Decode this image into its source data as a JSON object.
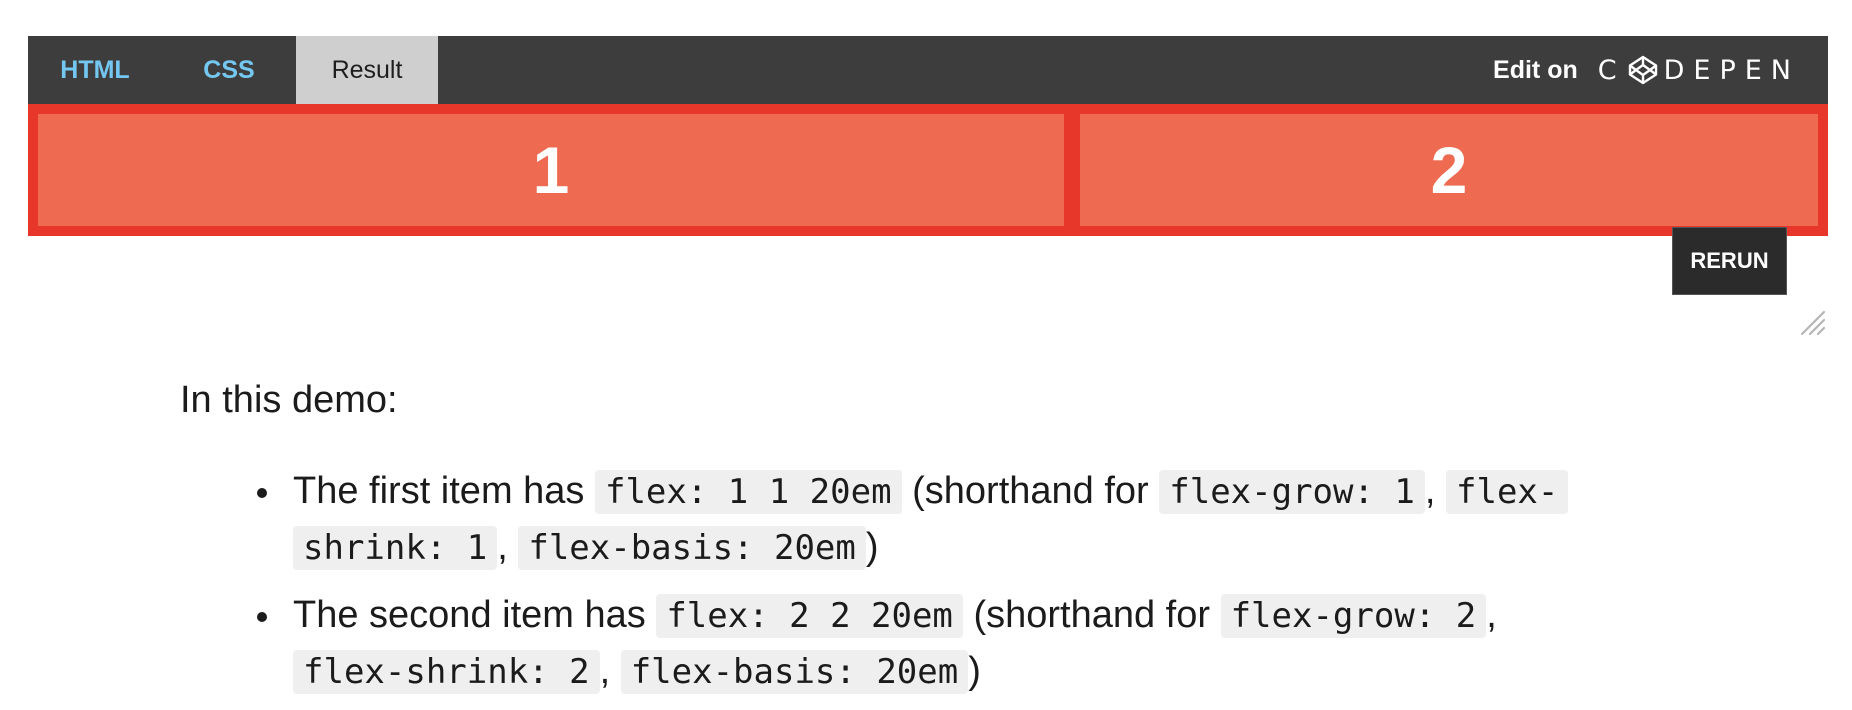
{
  "tabs": [
    {
      "label": "HTML"
    },
    {
      "label": "CSS"
    },
    {
      "label": "Result"
    }
  ],
  "brand": {
    "edit_label": "Edit on",
    "logo_text": "CODEPEN"
  },
  "result": {
    "item_1": "1",
    "item_2": "2"
  },
  "rerun_label": "RERUN",
  "article": {
    "intro": "In this demo:",
    "bullets": [
      {
        "prefix": "The first item has ",
        "code_main": "flex: 1 1 20em",
        "mid": " (shorthand for ",
        "code_grow": "flex-grow: 1",
        "code_shrink_a": "flex-",
        "code_shrink_b": "shrink: 1",
        "code_basis": "flex-basis: 20em",
        "sep": ", ",
        "suffix": ")"
      },
      {
        "prefix": "The second item has ",
        "code_main": "flex: 2 2 20em",
        "mid": " (shorthand for ",
        "code_grow": "flex-grow: 2",
        "code_shrink": "flex-shrink: 2",
        "code_basis": "flex-basis: 20em",
        "sep": ", ",
        "suffix": ")"
      }
    ]
  },
  "colors": {
    "header_bg": "#3d3d3d",
    "tab_link": "#74c7f0",
    "active_tab_bg": "#cfcfcf",
    "result_border": "#e6372a",
    "flex_item_bg": "#ee6b52",
    "rerun_bg": "#2b2b2b"
  },
  "icons": [
    "codepen-logo-icon",
    "resize-handle-icon"
  ]
}
